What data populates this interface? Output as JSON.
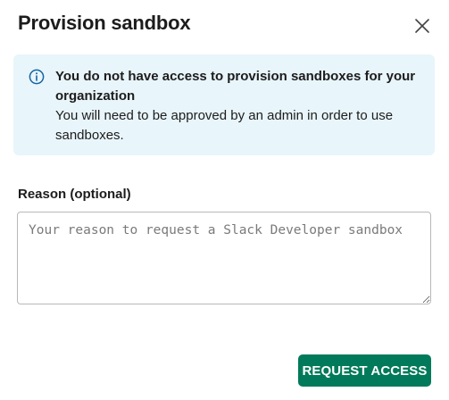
{
  "dialog": {
    "title": "Provision sandbox",
    "close_icon": "close-icon"
  },
  "banner": {
    "icon": "info-icon",
    "heading": "You do not have access to provision sandboxes for your organization",
    "body": "You will need to be approved by an admin in order to use sandboxes.",
    "background": "#e8f5fa",
    "icon_color": "#1264a3"
  },
  "reason": {
    "label": "Reason (optional)",
    "value": "",
    "placeholder": "Your reason to request a Slack Developer sandbox"
  },
  "actions": {
    "request_label": "REQUEST ACCESS",
    "request_color": "#007a5a"
  }
}
